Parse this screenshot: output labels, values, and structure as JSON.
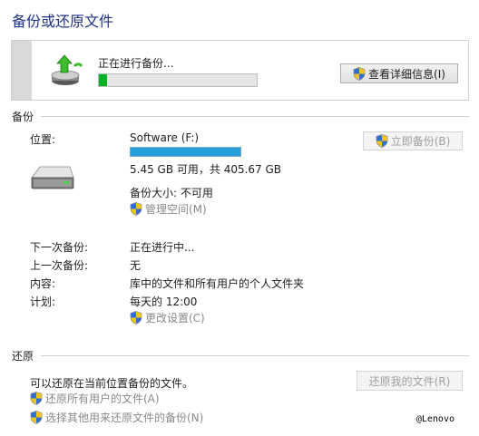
{
  "title": "备份或还原文件",
  "progress": {
    "status": "正在进行备份...",
    "fraction": 0.05,
    "details_button": "查看详细信息(I)"
  },
  "backup": {
    "section_label": "备份",
    "location_label": "位置:",
    "drive_name": "Software (F:)",
    "drive_used_fraction": 1.0,
    "free_space": "5.45 GB 可用，共 405.67 GB",
    "backup_size": "备份大小: 不可用",
    "manage_space": "管理空间(M)",
    "backup_now_button": "立即备份(B)",
    "next_backup_label": "下一次备份:",
    "next_backup_value": "正在进行中...",
    "last_backup_label": "上一次备份:",
    "last_backup_value": "无",
    "contents_label": "内容:",
    "contents_value": "库中的文件和所有用户的个人文件夹",
    "schedule_label": "计划:",
    "schedule_value": "每天的 12:00",
    "change_settings": "更改设置(C)"
  },
  "restore": {
    "section_label": "还原",
    "description": "可以还原在当前位置备份的文件。",
    "restore_my_files_button": "还原我的文件(R)",
    "restore_all_users": "还原所有用户的文件(A)",
    "select_other_backup": "选择其他用来还原文件的备份(N)"
  },
  "watermark": "@Lenovo",
  "colors": {
    "title": "#1e3287",
    "progress_green": "#06b025",
    "storage_blue": "#26a0da"
  },
  "icons": [
    "backup-drive-icon",
    "uac-shield-icon",
    "hard-drive-icon"
  ]
}
